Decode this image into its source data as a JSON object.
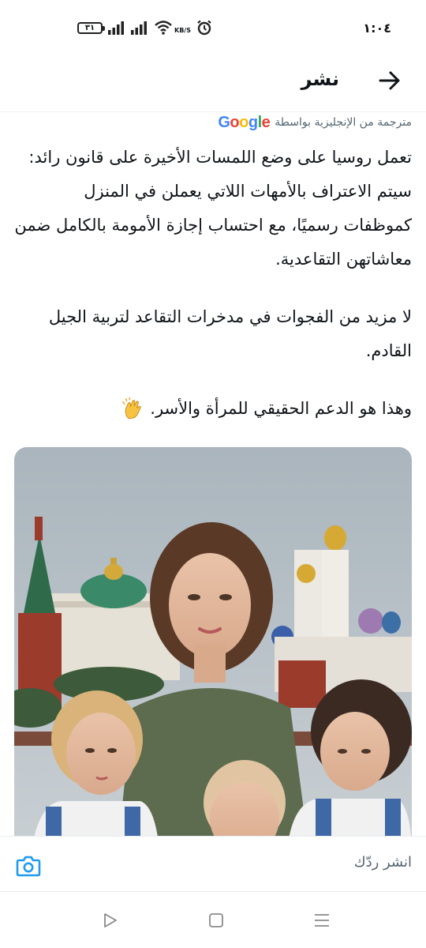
{
  "status_bar": {
    "time": "١:٠٤",
    "battery": "٣١",
    "speed_unit": "KB/S",
    "icons": [
      "battery-icon",
      "signal-icon",
      "signal-icon",
      "wifi-icon",
      "alarm-icon"
    ]
  },
  "header": {
    "title": "نشر",
    "back_icon": "arrow-back-icon"
  },
  "translation": {
    "label": "مترجمة من الإنجليزية بواسطة",
    "provider": "Google",
    "logo_colors": [
      "#4285F4",
      "#EA4335",
      "#FBBC05",
      "#4285F4",
      "#34A853",
      "#EA4335"
    ]
  },
  "tweet": {
    "paragraph_1": "تعمل روسيا على وضع اللمسات الأخيرة على قانون رائد: سيتم الاعتراف بالأمهات اللاتي يعملن في المنزل كموظفات رسميًا، مع احتساب إجازة الأمومة بالكامل ضمن معاشاتهن التقاعدية.",
    "paragraph_2": "لا مزيد من الفجوات في مدخرات التقاعد لتربية الجيل القادم.",
    "paragraph_3": "وهذا هو الدعم الحقيقي للمرأة والأسر.",
    "emoji": "clapping-hands-icon"
  },
  "reply": {
    "placeholder": "انشر ردّك",
    "camera_icon": "camera-icon"
  },
  "nav": {
    "icons": [
      "back-triangle-icon",
      "home-square-icon",
      "recents-menu-icon"
    ]
  },
  "colors": {
    "accent": "#1d9bf0",
    "text": "#0f1419",
    "muted": "#536471"
  }
}
